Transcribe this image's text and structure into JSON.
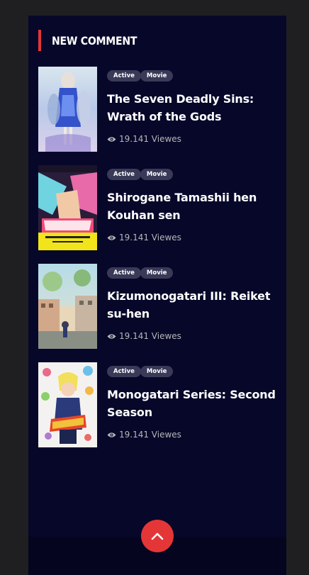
{
  "section": {
    "title": "NEW COMMENT"
  },
  "items": [
    {
      "tags": [
        "Active",
        "Movie"
      ],
      "title": "The Seven Deadly Sins: Wrath of the Gods",
      "views_text": "19.141 Viewes"
    },
    {
      "tags": [
        "Active",
        "Movie"
      ],
      "title": "Shirogane Tamashii hen Kouhan sen",
      "views_text": "19.141 Viewes"
    },
    {
      "tags": [
        "Active",
        "Movie"
      ],
      "title": "Kizumonogatari III: Reiket su-hen",
      "views_text": "19.141 Viewes"
    },
    {
      "tags": [
        "Active",
        "Movie"
      ],
      "title": "Monogatari Series: Second Season",
      "views_text": "19.141 Viewes"
    }
  ],
  "icons": {
    "views": "eye-icon",
    "back_to_top": "chevron-up-icon"
  },
  "colors": {
    "page_background": "#1f1f22",
    "panel_background": "#07072a",
    "accent": "#e53637",
    "tag_background": "#3a3a58",
    "text": "#ffffff",
    "muted_text": "#b7b7b7"
  }
}
